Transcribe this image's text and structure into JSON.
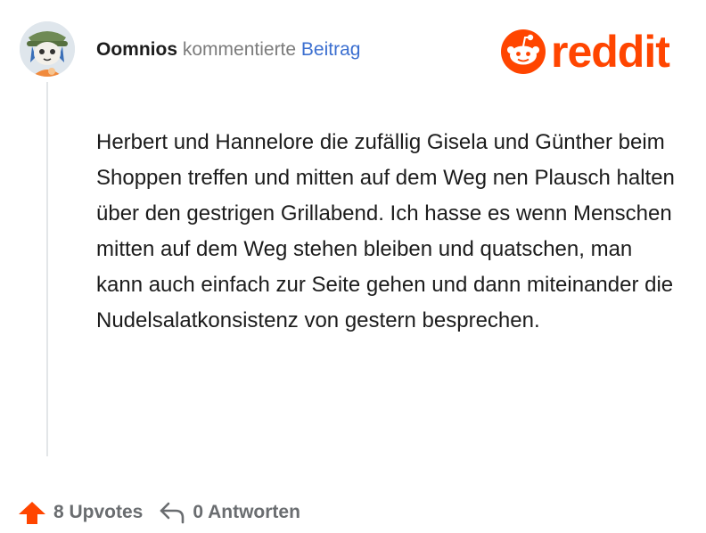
{
  "comment": {
    "username": "Oomnios",
    "action": "kommentierte",
    "target_link": "Beitrag",
    "body": "Herbert und Hannelore die zufällig Gisela und Günther beim Shoppen treffen und mitten auf dem Weg nen Plausch halten über den gestrigen Grillabend. Ich hasse es wenn Menschen mitten auf dem Weg stehen bleiben und quatschen, man kann auch einfach zur Seite gehen und dann miteinander die Nudelsalatkonsistenz von gestern besprechen."
  },
  "brand": {
    "name": "reddit",
    "color": "#ff4500"
  },
  "footer": {
    "upvotes_label": "8 Upvotes",
    "replies_label": "0 Antworten",
    "upvote_icon": "upvote-arrow-icon",
    "reply_icon": "reply-arrow-icon"
  }
}
